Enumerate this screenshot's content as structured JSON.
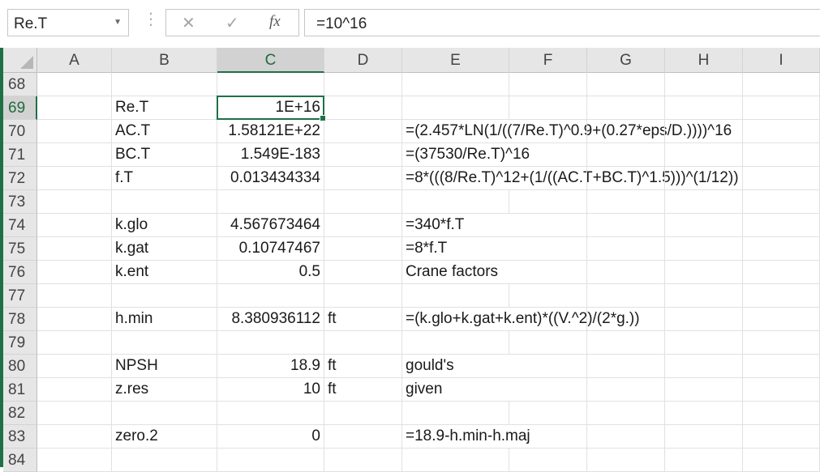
{
  "formula_bar": {
    "name_box": "Re.T",
    "name_box_dropdown_icon": "chevron-down-icon",
    "more_icon": "vertical-dots-icon",
    "cancel_icon": "✕",
    "enter_icon": "✓",
    "function_icon": "fx",
    "formula": "=10^16"
  },
  "accent_color": "#1e7145",
  "columns": [
    "A",
    "B",
    "C",
    "D",
    "E",
    "F",
    "G",
    "H",
    "I"
  ],
  "active_column": "C",
  "active_row": "69",
  "rows": [
    {
      "num": "68",
      "B": "",
      "C": "",
      "D": "",
      "E": ""
    },
    {
      "num": "69",
      "B": "Re.T",
      "C": "1E+16",
      "D": "",
      "E": ""
    },
    {
      "num": "70",
      "B": "AC.T",
      "C": "1.58121E+22",
      "D": "",
      "E": "=(2.457*LN(1/((7/Re.T)^0.9+(0.27*eps/D.))))^16"
    },
    {
      "num": "71",
      "B": "BC.T",
      "C": "1.549E-183",
      "D": "",
      "E": "=(37530/Re.T)^16"
    },
    {
      "num": "72",
      "B": "f.T",
      "C": "0.013434334",
      "D": "",
      "E": "=8*(((8/Re.T)^12+(1/((AC.T+BC.T)^1.5)))^(1/12))"
    },
    {
      "num": "73",
      "B": "",
      "C": "",
      "D": "",
      "E": ""
    },
    {
      "num": "74",
      "B": "k.glo",
      "C": "4.567673464",
      "D": "",
      "E": "=340*f.T"
    },
    {
      "num": "75",
      "B": "k.gat",
      "C": "0.10747467",
      "D": "",
      "E": "=8*f.T"
    },
    {
      "num": "76",
      "B": "k.ent",
      "C": "0.5",
      "D": "",
      "E": "Crane factors"
    },
    {
      "num": "77",
      "B": "",
      "C": "",
      "D": "",
      "E": ""
    },
    {
      "num": "78",
      "B": "h.min",
      "C": "8.380936112",
      "D": "ft",
      "E": "=(k.glo+k.gat+k.ent)*((V.^2)/(2*g.))"
    },
    {
      "num": "79",
      "B": "",
      "C": "",
      "D": "",
      "E": ""
    },
    {
      "num": "80",
      "B": "NPSH",
      "C": "18.9",
      "D": "ft",
      "E": "gould's"
    },
    {
      "num": "81",
      "B": "z.res",
      "C": "10",
      "D": "ft",
      "E": "given"
    },
    {
      "num": "82",
      "B": "",
      "C": "",
      "D": "",
      "E": ""
    },
    {
      "num": "83",
      "B": "zero.2",
      "C": "0",
      "D": "",
      "E": "=18.9-h.min-h.maj"
    },
    {
      "num": "84",
      "B": "",
      "C": "",
      "D": "",
      "E": ""
    }
  ]
}
